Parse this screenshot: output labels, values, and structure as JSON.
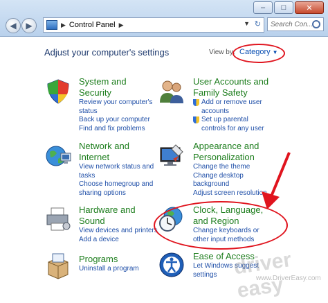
{
  "window": {
    "minimize_glyph": "‒",
    "maximize_glyph": "□",
    "close_glyph": "✕"
  },
  "address_bar": {
    "path": "Control Panel",
    "separator_glyph": "▶",
    "dropdown_glyph": "▼",
    "refresh_glyph": "↻",
    "icon": "control-panel-icon"
  },
  "search": {
    "placeholder": "Search Con..."
  },
  "nav": {
    "back_glyph": "◀",
    "forward_glyph": "▶"
  },
  "header": {
    "title": "Adjust your computer's settings",
    "view_by_label": "View by:",
    "view_by_value": "Category",
    "view_by_glyph": "▼"
  },
  "categories": {
    "system": {
      "title_line1": "System and",
      "title_line2": "Security",
      "links": [
        "Review your computer's",
        "status",
        "Back up your computer",
        "Find and fix problems"
      ],
      "icon": "shield-security-icon"
    },
    "user_accounts": {
      "title_line1": "User Accounts and",
      "title_line2": "Family Safety",
      "links": [
        "Add or remove user",
        "accounts",
        "Set up parental",
        "controls for any user"
      ],
      "icon": "users-icon"
    },
    "network": {
      "title_line1": "Network and",
      "title_line2": "Internet",
      "links": [
        "View network status and",
        "tasks",
        "Choose homegroup and",
        "sharing options"
      ],
      "icon": "network-globe-icon"
    },
    "appearance": {
      "title_line1": "Appearance and",
      "title_line2": "Personalization",
      "links": [
        "Change the theme",
        "Change desktop",
        "background",
        "Adjust screen resolution"
      ],
      "icon": "monitor-paint-icon"
    },
    "hardware": {
      "title_line1": "Hardware and",
      "title_line2": "Sound",
      "links": [
        "View devices and printers",
        "Add a device"
      ],
      "icon": "printer-icon"
    },
    "clock": {
      "title_line1": "Clock, Language,",
      "title_line2": "and Region",
      "links": [
        "Change keyboards or",
        "other input methods"
      ],
      "icon": "clock-globe-icon"
    },
    "programs": {
      "title_line1": "Programs",
      "links": [
        "Uninstall a program"
      ],
      "icon": "programs-box-icon"
    },
    "ease": {
      "title_line1": "Ease of Access",
      "links": [
        "Let Windows suggest",
        "settings"
      ],
      "icon": "ease-of-access-icon"
    }
  },
  "annotations": {
    "highlight_color": "#e0141e"
  },
  "watermark": {
    "logo_text": "driver easy",
    "url": "www.DriverEasy.com"
  }
}
